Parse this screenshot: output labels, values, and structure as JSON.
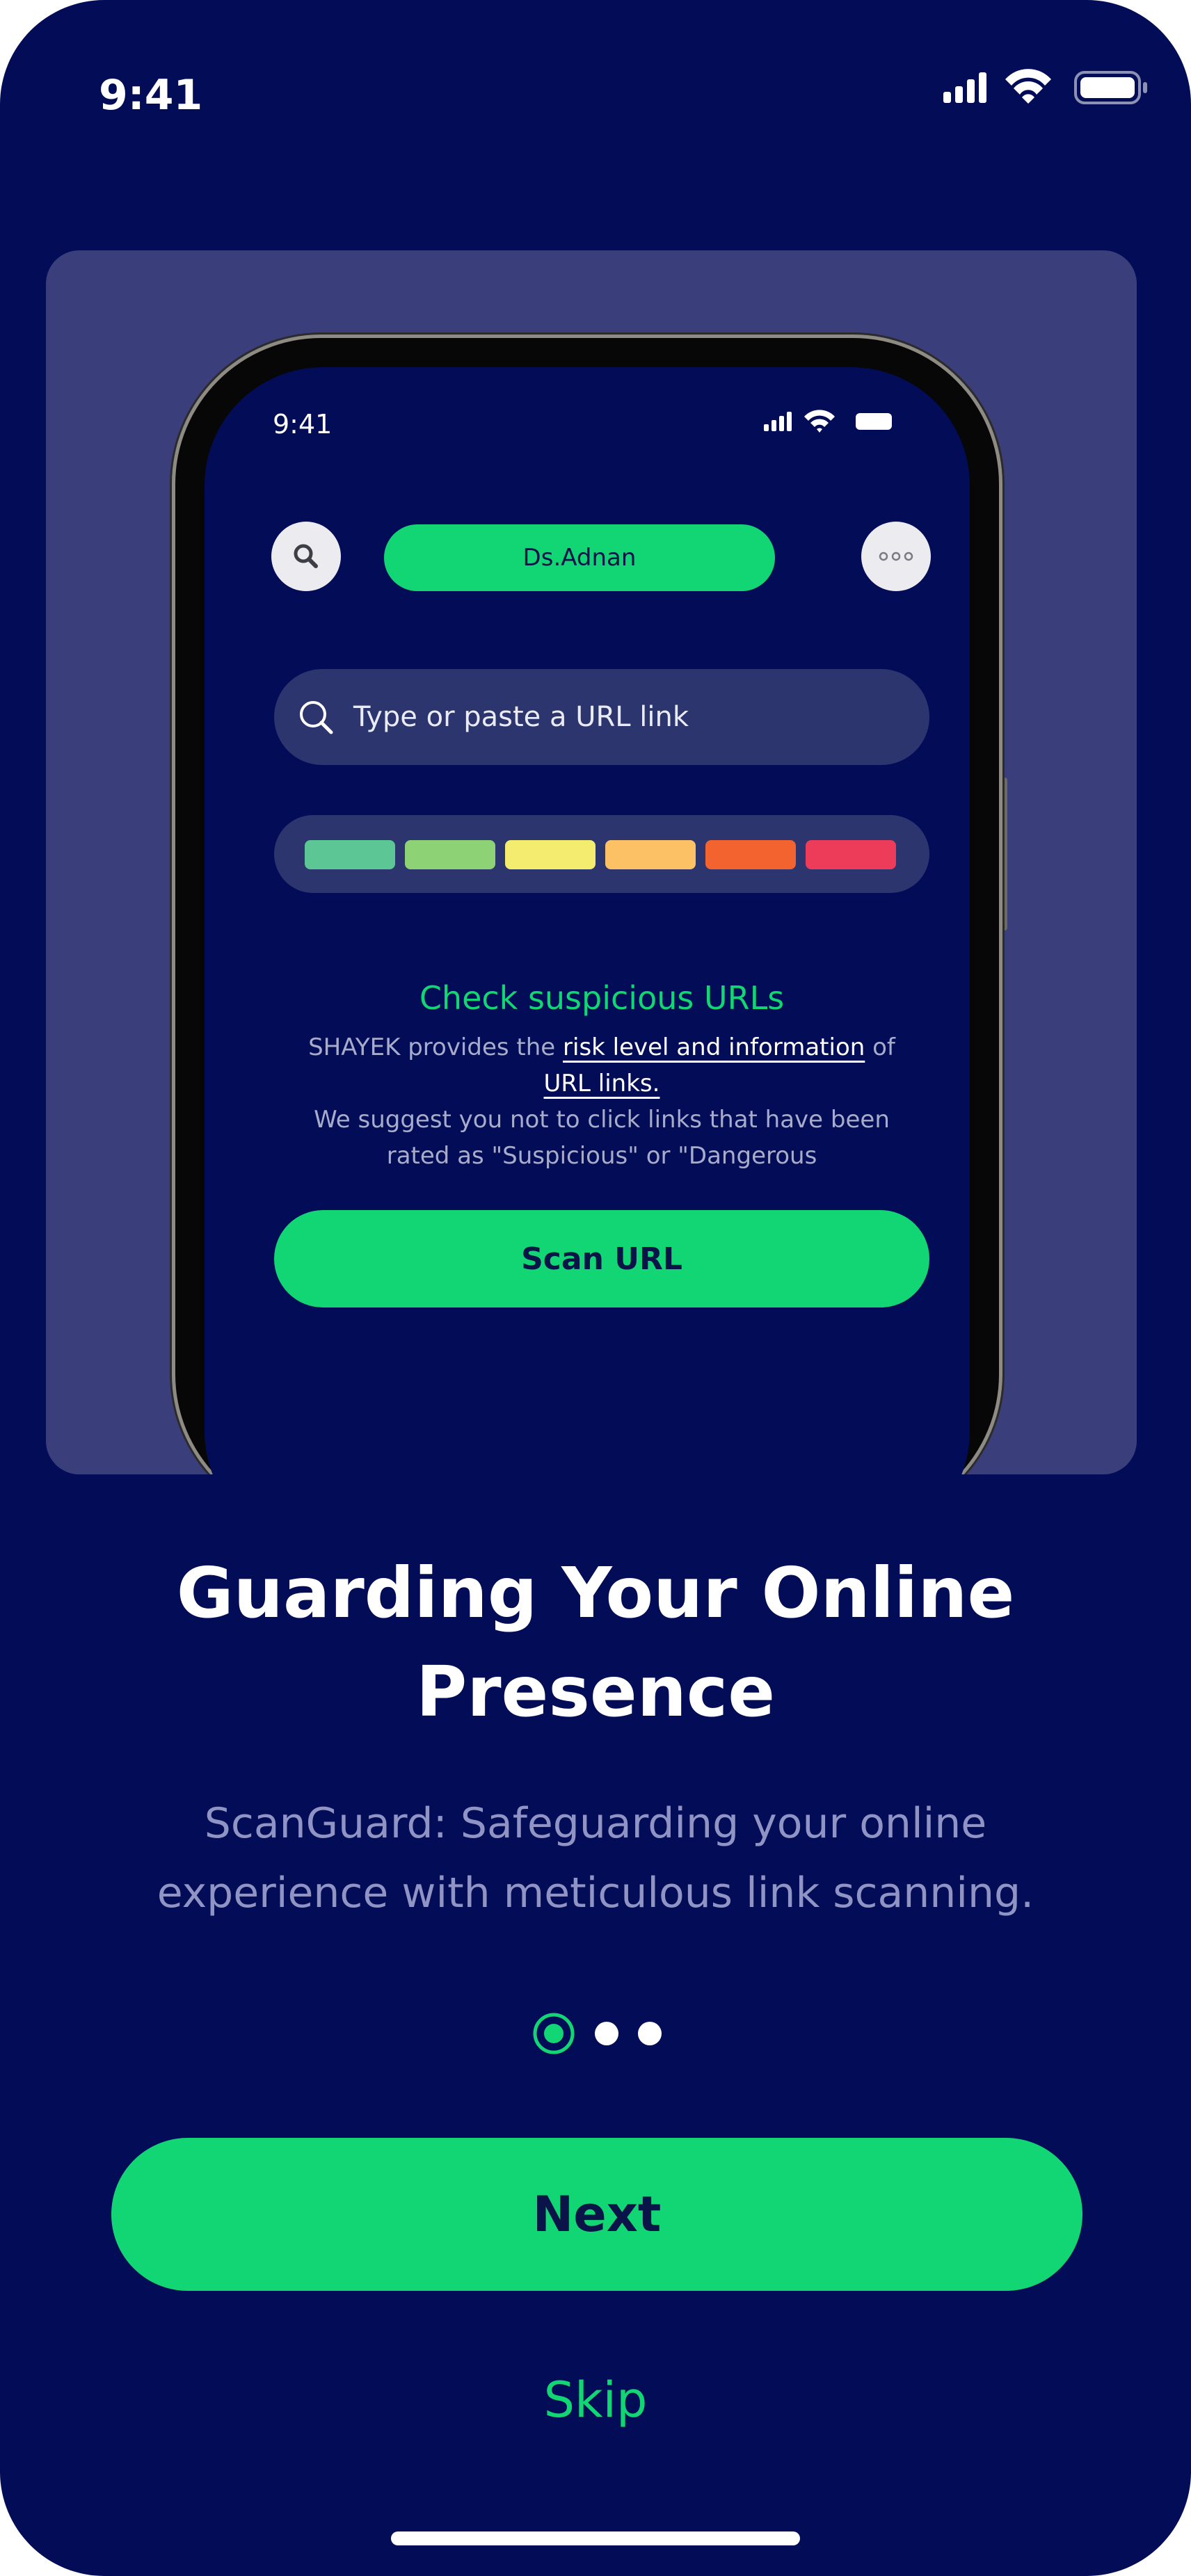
{
  "status_bar": {
    "time": "9:41"
  },
  "hero_mockup": {
    "time": "9:41",
    "username": "Ds.Adnan",
    "url_placeholder": "Type or paste a URL link",
    "risk_scale_colors": [
      "#5cc694",
      "#8dd376",
      "#f3ec6f",
      "#fcc165",
      "#f2632f",
      "#ec3c59"
    ],
    "check_title": "Check suspicious URLs",
    "desc_prefix": "SHAYEK provides the ",
    "desc_highlight1": "risk level and information",
    "desc_mid": " of",
    "desc_highlight2": "URL links.",
    "desc_suffix": "We suggest you not to click links that have been rated as \"Suspicious\" or \"Dangerous",
    "scan_button": "Scan URL"
  },
  "onboarding": {
    "title": "Guarding Your Online Presence",
    "subtitle": "ScanGuard: Safeguarding your online experience with meticulous link scanning.",
    "page_indicator": {
      "current": 1,
      "total": 3
    },
    "next_button": "Next",
    "skip_link": "Skip"
  },
  "colors": {
    "background": "#030c56",
    "accent": "#12d574",
    "card": "#3a3f7c"
  }
}
